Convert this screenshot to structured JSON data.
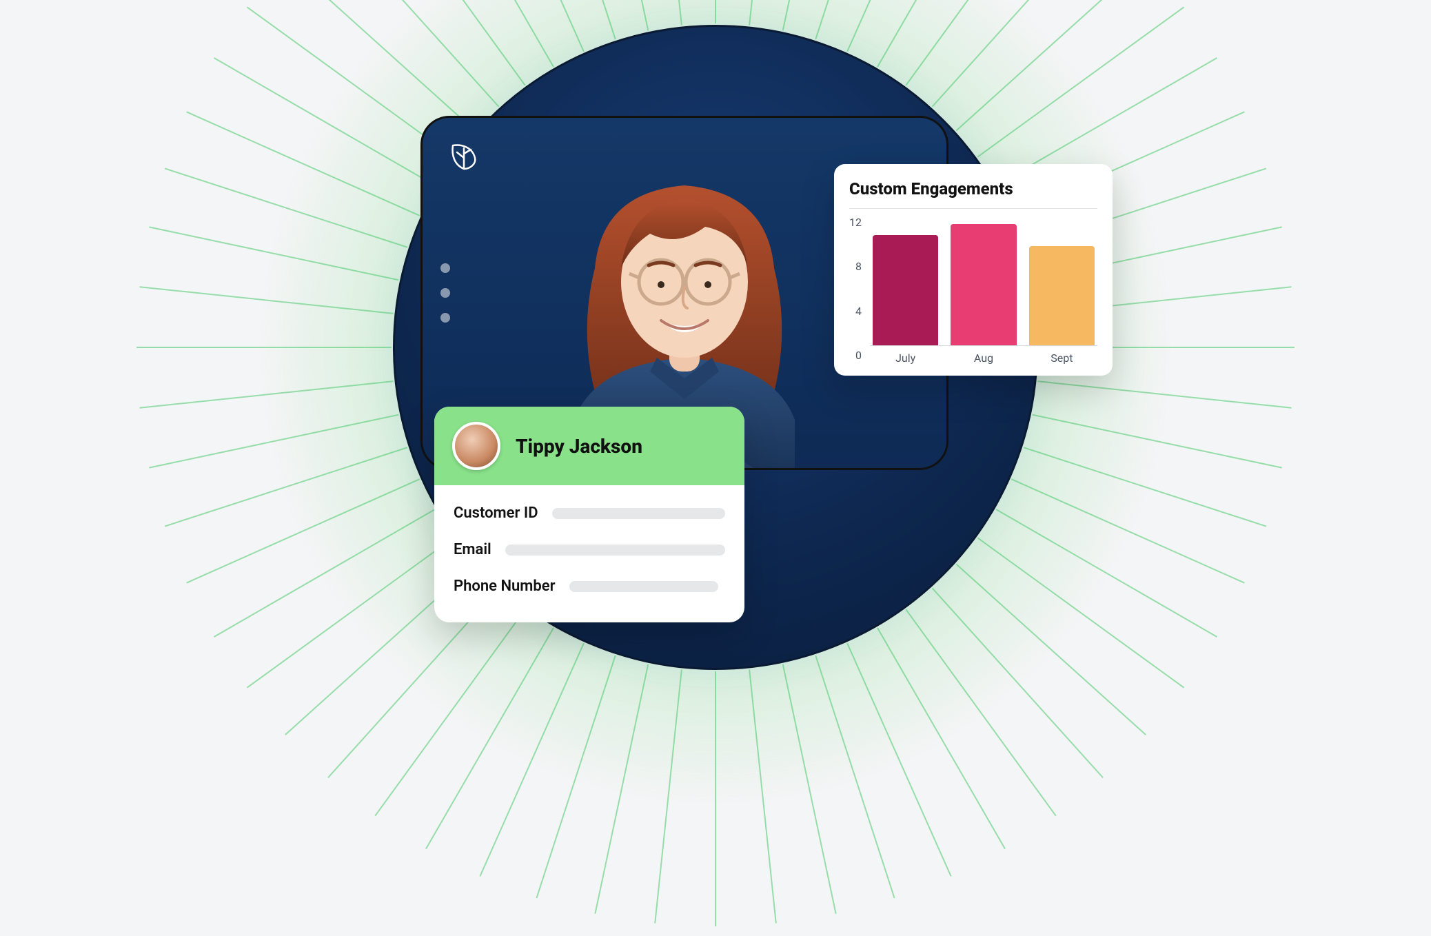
{
  "contact": {
    "name": "Tippy Jackson",
    "fields": [
      {
        "label": "Customer ID"
      },
      {
        "label": "Email"
      },
      {
        "label": "Phone Number"
      }
    ]
  },
  "chart": {
    "title": "Custom Engagements"
  },
  "chart_data": {
    "type": "bar",
    "title": "Custom Engagements",
    "xlabel": "",
    "ylabel": "",
    "categories": [
      "July",
      "Aug",
      "Sept"
    ],
    "values": [
      10,
      11,
      9
    ],
    "ylim": [
      0,
      12
    ],
    "yticks": [
      0,
      4,
      8,
      12
    ],
    "colors": [
      "#a81b55",
      "#e83d72",
      "#f6b860"
    ]
  }
}
